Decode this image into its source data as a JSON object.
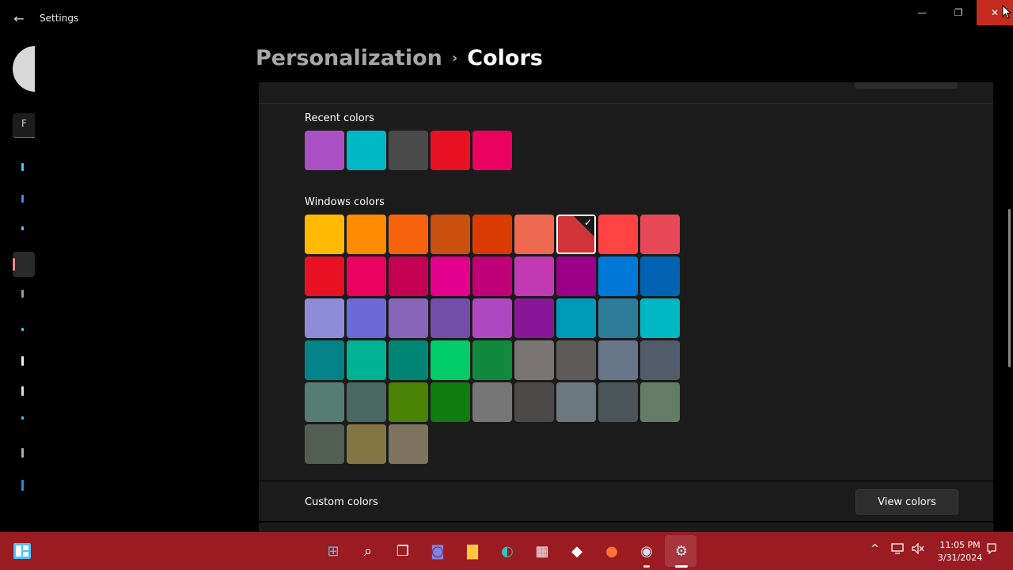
{
  "window": {
    "title": "Settings",
    "back_icon": "←",
    "minimize_icon": "—",
    "maximize_icon": "❐",
    "close_icon": "✕"
  },
  "nav": {
    "search_letter": "F"
  },
  "breadcrumb": {
    "parent": "Personalization",
    "separator": "›",
    "current": "Colors"
  },
  "recent_colors": {
    "label": "Recent colors",
    "swatches": [
      "#aa4fc4",
      "#00b7c3",
      "#4a4a4a",
      "#e81123",
      "#ea005e"
    ]
  },
  "windows_colors": {
    "label": "Windows colors",
    "selected_color": "#d13438",
    "rows": [
      [
        "#ffb900",
        "#ff8c00",
        "#f7630c",
        "#ca5010",
        "#da3b01",
        "#ef6950",
        "#d13438",
        "#ff4343",
        "#e74856"
      ],
      [
        "#e81123",
        "#ea005e",
        "#c30052",
        "#e3008c",
        "#bf0077",
        "#c239b3",
        "#9a0089",
        "#0078d7",
        "#0063b1"
      ],
      [
        "#8e8cd8",
        "#6b69d6",
        "#8764b8",
        "#744da9",
        "#b146c2",
        "#881798",
        "#0099bc",
        "#2d7d9a",
        "#00b7c3"
      ],
      [
        "#038387",
        "#00b294",
        "#018574",
        "#00cc6a",
        "#10893e",
        "#7a7574",
        "#5d5a58",
        "#68768a",
        "#515c6b"
      ],
      [
        "#567c73",
        "#486860",
        "#498205",
        "#107c10",
        "#767676",
        "#4c4a48",
        "#69797e",
        "#4a5459",
        "#647c64"
      ],
      [
        "#525e54",
        "#847545",
        "#7e735f"
      ]
    ],
    "check_icon": "✓"
  },
  "custom_colors": {
    "label": "Custom colors",
    "button_label": "View colors"
  },
  "taskbar": {
    "apps": [
      {
        "name": "start",
        "glyph": "⊞",
        "color": "#4cc2ff"
      },
      {
        "name": "search",
        "glyph": "⌕",
        "color": "#ffffff"
      },
      {
        "name": "task-view",
        "glyph": "❐",
        "color": "#ffffff"
      },
      {
        "name": "chat",
        "glyph": "◙",
        "color": "#7b83eb"
      },
      {
        "name": "file-explorer",
        "glyph": "▇",
        "color": "#ffc83d"
      },
      {
        "name": "edge",
        "glyph": "◐",
        "color": "#36c3b2"
      },
      {
        "name": "store",
        "glyph": "▦",
        "color": "#ffffff"
      },
      {
        "name": "roblox",
        "glyph": "◆",
        "color": "#ffffff"
      },
      {
        "name": "firefox",
        "glyph": "●",
        "color": "#ff7139"
      },
      {
        "name": "steam",
        "glyph": "◉",
        "color": "#cfe3f5"
      },
      {
        "name": "settings",
        "glyph": "⚙",
        "color": "#cfe3f5"
      }
    ],
    "tray": {
      "chevron": "^",
      "clock_time": "11:05 PM",
      "clock_date": "3/31/2024"
    }
  }
}
